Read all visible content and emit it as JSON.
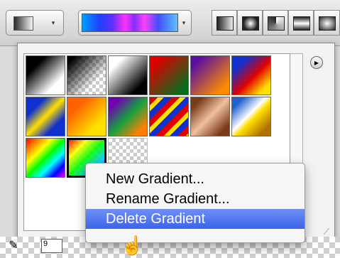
{
  "toolbar": {
    "swatch_arrow": "▾",
    "gradient_arrow": "▾"
  },
  "panel": {
    "menu_icon": "▶",
    "resize_icon": "⟋"
  },
  "context_menu": {
    "items": [
      {
        "label": "New Gradient..."
      },
      {
        "label": "Rename Gradient..."
      },
      {
        "label": "Delete Gradient"
      }
    ]
  },
  "options": {
    "size_value": "9"
  },
  "icons": {
    "eyedropper": "✎",
    "cursor": "☝"
  },
  "colors": {
    "menu_highlight": "#3b63ea",
    "panel_bg": "#f2f2f2"
  }
}
